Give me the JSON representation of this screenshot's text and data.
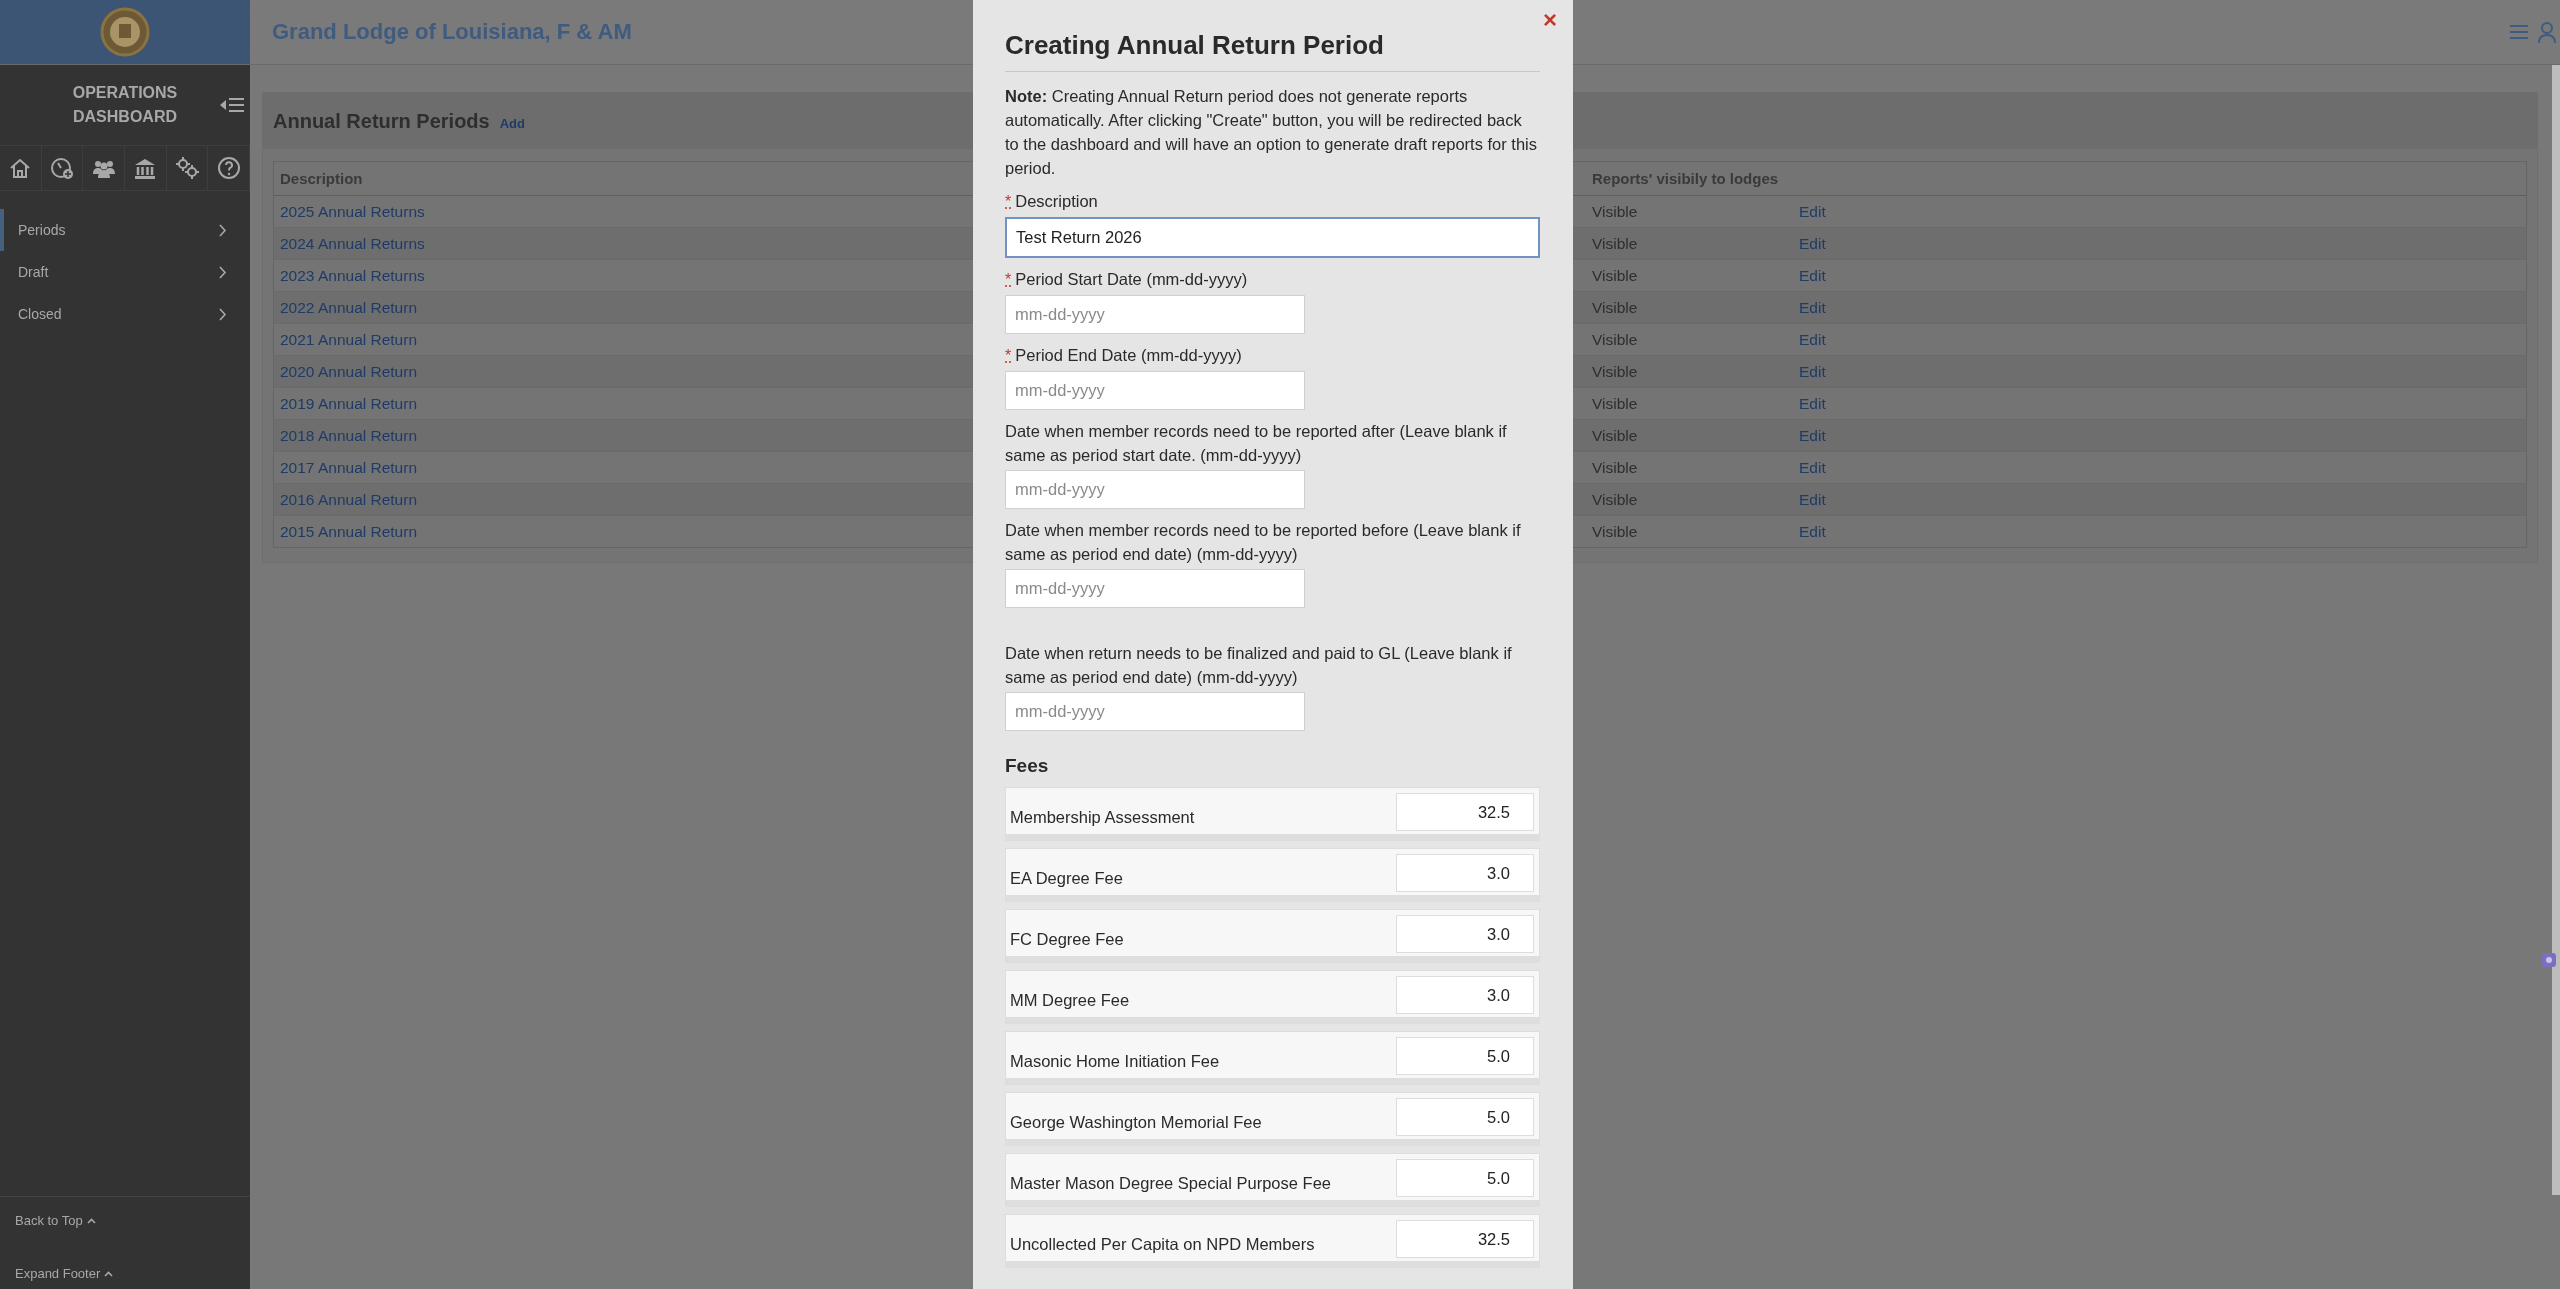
{
  "header": {
    "title": "Grand Lodge of Louisiana, F & AM"
  },
  "sidebar": {
    "title": "OPERATIONS DASHBOARD",
    "items": [
      {
        "label": "Periods",
        "selected": true
      },
      {
        "label": "Draft",
        "selected": false
      },
      {
        "label": "Closed",
        "selected": false
      }
    ],
    "footer_links": [
      "Back to Top",
      "Expand Footer"
    ]
  },
  "panel": {
    "title": "Annual Return Periods",
    "add_link": "Add",
    "table": {
      "columns": [
        "Description",
        "Reports' visibily to lodges"
      ],
      "rows": [
        {
          "description": "2025 Annual Returns",
          "visibility": "Visible",
          "action": "Edit"
        },
        {
          "description": "2024 Annual Returns",
          "visibility": "Visible",
          "action": "Edit"
        },
        {
          "description": "2023 Annual Returns",
          "visibility": "Visible",
          "action": "Edit"
        },
        {
          "description": "2022 Annual Return",
          "visibility": "Visible",
          "action": "Edit"
        },
        {
          "description": "2021 Annual Return",
          "visibility": "Visible",
          "action": "Edit"
        },
        {
          "description": "2020 Annual Return",
          "visibility": "Visible",
          "action": "Edit"
        },
        {
          "description": "2019 Annual Return",
          "visibility": "Visible",
          "action": "Edit"
        },
        {
          "description": "2018 Annual Return",
          "visibility": "Visible",
          "action": "Edit"
        },
        {
          "description": "2017 Annual Return",
          "visibility": "Visible",
          "action": "Edit"
        },
        {
          "description": "2016 Annual Return",
          "visibility": "Visible",
          "action": "Edit"
        },
        {
          "description": "2015 Annual Return",
          "visibility": "Visible",
          "action": "Edit"
        }
      ]
    }
  },
  "modal": {
    "title": "Creating Annual Return Period",
    "close": "×",
    "required_mark": "*",
    "note": "**Note:** Creating Annual Return period does not generate reports automatically. After clicking \"Create\" button, you will be redirected back to the dashboard and will have an option to generate draft reports for this period.",
    "fields": [
      {
        "label": "Description",
        "required": true,
        "value": "Test Return 2026",
        "focused": true,
        "wide": true
      },
      {
        "label": "Period Start Date (mm-dd-yyyy)",
        "required": true,
        "placeholder": "mm-dd-yyyy",
        "focused": false,
        "wide": false
      },
      {
        "label": "Period End Date (mm-dd-yyyy)",
        "required": true,
        "placeholder": "mm-dd-yyyy",
        "focused": false,
        "wide": false
      },
      {
        "label": "Date when member records need to be reported after (Leave blank if same as period start date. (mm-dd-yyyy)",
        "required": false,
        "placeholder": "mm-dd-yyyy",
        "focused": false,
        "wide": false
      },
      {
        "label": "Date when member records need to be reported before (Leave blank if same as period end date) (mm-dd-yyyy)",
        "required": false,
        "placeholder": "mm-dd-yyyy",
        "focused": false,
        "wide": false
      },
      {
        "label": "Date when return needs to be finalized and paid to GL (Leave blank if same as period end date) (mm-dd-yyyy)",
        "required": false,
        "placeholder": "mm-dd-yyyy",
        "focused": false,
        "wide": false
      }
    ],
    "fees_title": "Fees",
    "fees": [
      {
        "label": "Membership Assessment",
        "value": "32.5"
      },
      {
        "label": "EA Degree Fee",
        "value": "3.0"
      },
      {
        "label": "FC Degree Fee",
        "value": "3.0"
      },
      {
        "label": "MM Degree Fee",
        "value": "3.0"
      },
      {
        "label": "Masonic Home Initiation Fee",
        "value": "5.0"
      },
      {
        "label": "George Washington Memorial Fee",
        "value": "5.0"
      },
      {
        "label": "Master Mason Degree Special Purpose Fee",
        "value": "5.0"
      },
      {
        "label": "Uncollected Per Capita on NPD Members",
        "value": "32.5"
      }
    ]
  }
}
